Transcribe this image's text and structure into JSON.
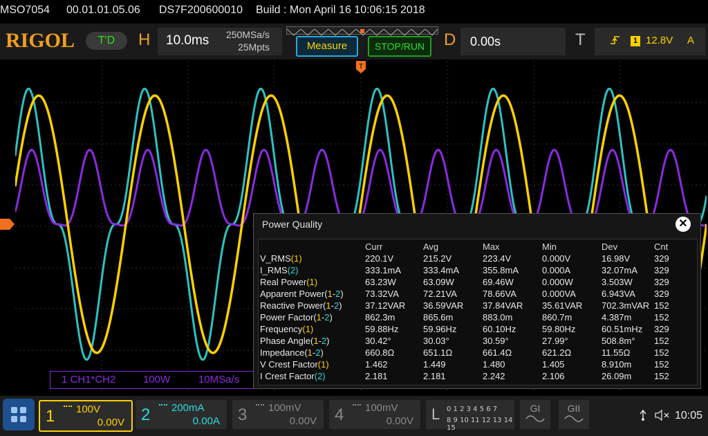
{
  "system": {
    "model": "MSO7054",
    "firmware": "00.01.01.05.06",
    "serial": "DS7F200600010",
    "build": "Build : Mon April 16 10:06:15 2018"
  },
  "topbar": {
    "logo": "RIGOL",
    "trigger_status": "T'D",
    "horizontal": {
      "label": "H",
      "timebase": "10.0ms",
      "sample_rate": "250MSa/s",
      "memory_depth": "25Mpts"
    },
    "measure_label": "Measure",
    "run_label": "STOP/RUN",
    "delay": {
      "label": "D",
      "value": "0.00s"
    },
    "trigger": {
      "label": "T",
      "edge_icon": "rising-edge-icon",
      "source": "1",
      "level": "12.8V",
      "mode": "A"
    }
  },
  "math_label": {
    "channel": "1  CH1*CH2",
    "scale": "100W",
    "rate": "10MSa/s"
  },
  "power_quality": {
    "title": "Power Quality",
    "columns": [
      "Curr",
      "Avg",
      "Max",
      "Min",
      "Dev",
      "Cnt"
    ],
    "rows": [
      {
        "name": "V_RMS",
        "src": "(1)",
        "src_a": "1",
        "vals": [
          "220.1V",
          "215.2V",
          "223.4V",
          "0.000V",
          "16.98V",
          "329"
        ]
      },
      {
        "name": "I_RMS",
        "src": "(2)",
        "src_a": "2",
        "vals": [
          "333.1mA",
          "333.4mA",
          "355.8mA",
          "0.000A",
          "32.07mA",
          "329"
        ]
      },
      {
        "name": "Real Power",
        "src": "(1)",
        "src_a": "1",
        "vals": [
          "63.23W",
          "63.09W",
          "69.46W",
          "0.000W",
          "3.503W",
          "329"
        ]
      },
      {
        "name": "Apparent Power",
        "src": "(1-2)",
        "vals": [
          "73.32VA",
          "72.21VA",
          "78.66VA",
          "0.000VA",
          "6.943VA",
          "329"
        ]
      },
      {
        "name": "Reactive Power",
        "src": "(1-2)",
        "vals": [
          "37.12VAR",
          "36.59VAR",
          "37.84VAR",
          "35.61VAR",
          "702.3mVAR",
          "152"
        ]
      },
      {
        "name": "Power Factor",
        "src": "(1-2)",
        "vals": [
          "862.3m",
          "865.6m",
          "883.0m",
          "860.7m",
          "4.387m",
          "152"
        ]
      },
      {
        "name": "Frequency",
        "src": "(1)",
        "src_a": "1",
        "vals": [
          "59.88Hz",
          "59.96Hz",
          "60.10Hz",
          "59.80Hz",
          "60.51mHz",
          "329"
        ]
      },
      {
        "name": "Phase Angle",
        "src": "(1-2)",
        "vals": [
          "30.42°",
          "30.03°",
          "30.59°",
          "27.99°",
          "508.8m°",
          "152"
        ]
      },
      {
        "name": "Impedance",
        "src": "(1-2)",
        "vals": [
          "660.8Ω",
          "651.1Ω",
          "661.4Ω",
          "621.2Ω",
          "11.55Ω",
          "152"
        ]
      },
      {
        "name": "V Crest Factor",
        "src": "(1)",
        "src_a": "1",
        "vals": [
          "1.462",
          "1.449",
          "1.480",
          "1.405",
          "8.910m",
          "152"
        ]
      },
      {
        "name": "I Crest Factor",
        "src": "(2)",
        "src_a": "2",
        "vals": [
          "2.181",
          "2.181",
          "2.242",
          "2.106",
          "26.09m",
          "152"
        ]
      }
    ]
  },
  "channels": [
    {
      "num": "1",
      "scale": "100V",
      "offset": "0.00V",
      "color": "#ffd000"
    },
    {
      "num": "2",
      "scale": "200mA",
      "offset": "0.00A",
      "color": "#30d8d8"
    },
    {
      "num": "3",
      "scale": "100mV",
      "offset": "0.00V",
      "color": "#888888"
    },
    {
      "num": "4",
      "scale": "100mV",
      "offset": "0.00V",
      "color": "#888888"
    }
  ],
  "logic": {
    "label": "L",
    "digits_row1": "0 1 2 3  4 5 6 7",
    "digits_row2": "8 9 10 11 12 13 14 15"
  },
  "generators": [
    "GI",
    "GII"
  ],
  "status": {
    "time": "10:05"
  },
  "colors": {
    "ch1": "#ffd000",
    "ch2": "#30d8d8",
    "math": "#8a2be2",
    "accent": "#f0a020"
  }
}
